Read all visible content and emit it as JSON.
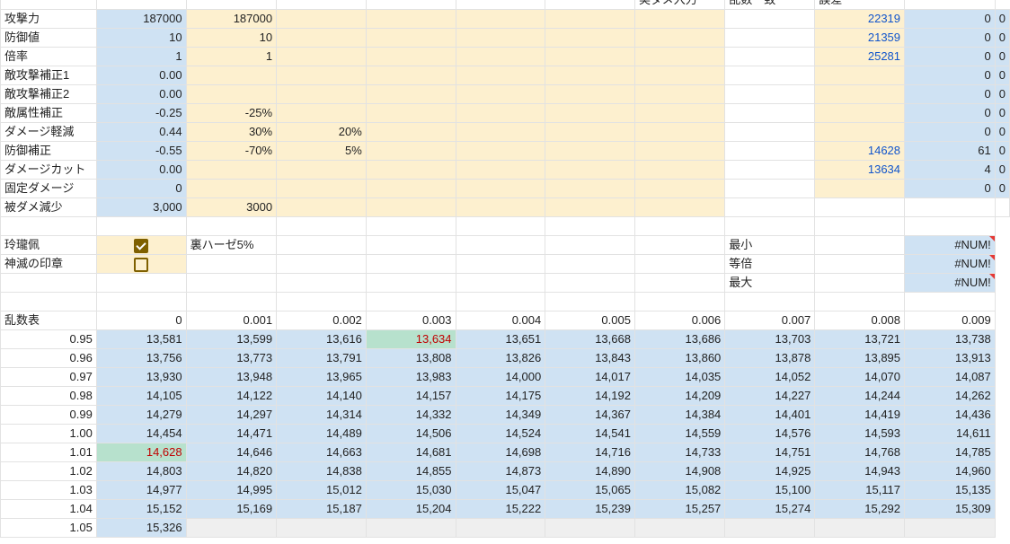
{
  "header": {
    "h8": "実ダメ入力",
    "h9": "乱数一致",
    "h10": "誤差"
  },
  "params": [
    {
      "label": "攻撃力",
      "v": "187000",
      "v2": "187000",
      "v3": "",
      "real": "22319",
      "match": "0",
      "err": "0"
    },
    {
      "label": "防御値",
      "v": "10",
      "v2": "10",
      "v3": "",
      "real": "21359",
      "match": "0",
      "err": "0"
    },
    {
      "label": "倍率",
      "v": "1",
      "v2": "1",
      "v3": "",
      "real": "25281",
      "match": "0",
      "err": "0"
    },
    {
      "label": "敵攻撃補正1",
      "v": "0.00",
      "v2": "",
      "v3": "",
      "real": "",
      "match": "0",
      "err": "0"
    },
    {
      "label": "敵攻撃補正2",
      "v": "0.00",
      "v2": "",
      "v3": "",
      "real": "",
      "match": "0",
      "err": "0"
    },
    {
      "label": "敵属性補正",
      "v": "-0.25",
      "v2": "-25%",
      "v3": "",
      "real": "",
      "match": "0",
      "err": "0"
    },
    {
      "label": "ダメージ軽減",
      "v": "0.44",
      "v2": "30%",
      "v3": "20%",
      "real": "",
      "match": "0",
      "err": "0"
    },
    {
      "label": "防御補正",
      "v": "-0.55",
      "v2": "-70%",
      "v3": "5%",
      "real": "14628",
      "match": "61",
      "err": "0"
    },
    {
      "label": "ダメージカット",
      "v": "0.00",
      "v2": "",
      "v3": "",
      "real": "13634",
      "match": "4",
      "err": "0"
    },
    {
      "label": "固定ダメージ",
      "v": "0",
      "v2": "",
      "v3": "",
      "real": "",
      "match": "0",
      "err": "0"
    },
    {
      "label": "被ダメ減少",
      "v": "3,000",
      "v2": "3000",
      "v3": ""
    }
  ],
  "checks": [
    {
      "label": "玲瓏佩",
      "checked": true
    },
    {
      "label": "神滅の印章",
      "checked": false
    }
  ],
  "note": "裏ハーゼ5%",
  "stats": [
    {
      "label": "最小",
      "value": "#NUM!"
    },
    {
      "label": "等倍",
      "value": "#NUM!"
    },
    {
      "label": "最大",
      "value": "#NUM!"
    }
  ],
  "rand": {
    "title": "乱数表",
    "cols": [
      "0",
      "0.001",
      "0.002",
      "0.003",
      "0.004",
      "0.005",
      "0.006",
      "0.007",
      "0.008",
      "0.009"
    ],
    "rows": [
      {
        "k": "0.95",
        "vals": [
          "13,581",
          "13,599",
          "13,616",
          "13,634",
          "13,651",
          "13,668",
          "13,686",
          "13,703",
          "13,721",
          "13,738"
        ]
      },
      {
        "k": "0.96",
        "vals": [
          "13,756",
          "13,773",
          "13,791",
          "13,808",
          "13,826",
          "13,843",
          "13,860",
          "13,878",
          "13,895",
          "13,913"
        ]
      },
      {
        "k": "0.97",
        "vals": [
          "13,930",
          "13,948",
          "13,965",
          "13,983",
          "14,000",
          "14,017",
          "14,035",
          "14,052",
          "14,070",
          "14,087"
        ]
      },
      {
        "k": "0.98",
        "vals": [
          "14,105",
          "14,122",
          "14,140",
          "14,157",
          "14,175",
          "14,192",
          "14,209",
          "14,227",
          "14,244",
          "14,262"
        ]
      },
      {
        "k": "0.99",
        "vals": [
          "14,279",
          "14,297",
          "14,314",
          "14,332",
          "14,349",
          "14,367",
          "14,384",
          "14,401",
          "14,419",
          "14,436"
        ]
      },
      {
        "k": "1.00",
        "vals": [
          "14,454",
          "14,471",
          "14,489",
          "14,506",
          "14,524",
          "14,541",
          "14,559",
          "14,576",
          "14,593",
          "14,611"
        ]
      },
      {
        "k": "1.01",
        "vals": [
          "14,628",
          "14,646",
          "14,663",
          "14,681",
          "14,698",
          "14,716",
          "14,733",
          "14,751",
          "14,768",
          "14,785"
        ]
      },
      {
        "k": "1.02",
        "vals": [
          "14,803",
          "14,820",
          "14,838",
          "14,855",
          "14,873",
          "14,890",
          "14,908",
          "14,925",
          "14,943",
          "14,960"
        ]
      },
      {
        "k": "1.03",
        "vals": [
          "14,977",
          "14,995",
          "15,012",
          "15,030",
          "15,047",
          "15,065",
          "15,082",
          "15,100",
          "15,117",
          "15,135"
        ]
      },
      {
        "k": "1.04",
        "vals": [
          "15,152",
          "15,169",
          "15,187",
          "15,204",
          "15,222",
          "15,239",
          "15,257",
          "15,274",
          "15,292",
          "15,309"
        ]
      },
      {
        "k": "1.05",
        "vals": [
          "15,326",
          "",
          "",
          "",
          "",
          "",
          "",
          "",
          "",
          ""
        ]
      }
    ],
    "highlights": [
      {
        "row": 0,
        "col": 3
      },
      {
        "row": 6,
        "col": 0
      }
    ]
  },
  "colors": {
    "blue": "#cfe2f3",
    "yellow": "#fdf0cf",
    "green": "#b7e1cd",
    "highlight_text": "#c00000",
    "link": "#1155cc"
  }
}
